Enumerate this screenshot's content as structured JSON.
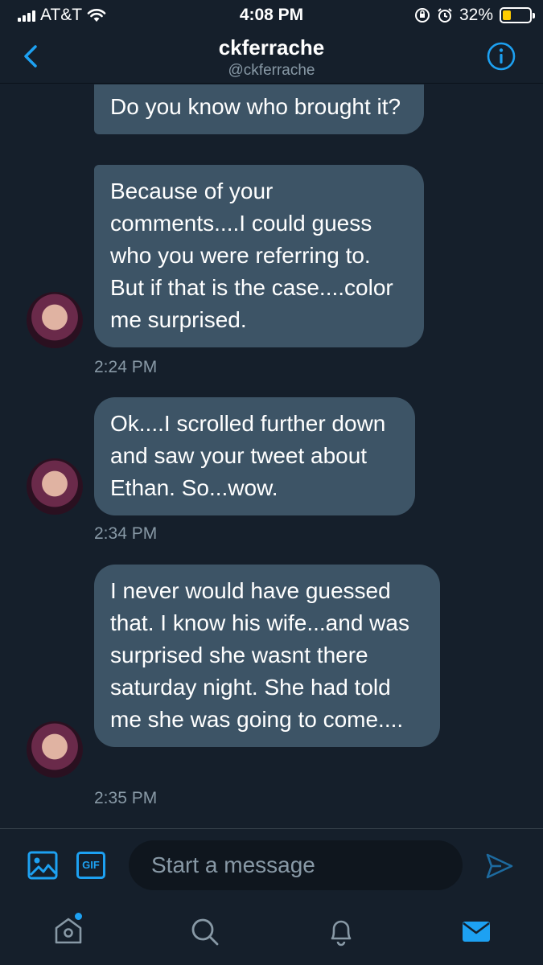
{
  "status_bar": {
    "carrier": "AT&T",
    "time": "4:08 PM",
    "battery": "32%",
    "battery_level": 0.32
  },
  "header": {
    "name": "ckferrache",
    "handle": "@ckferrache"
  },
  "messages": [
    {
      "text": "Do you know who brought it?"
    },
    {
      "text": "Because of your comments....I could guess who you were referring to. But if that is the case....color me surprised."
    },
    {
      "text": "Ok....I scrolled further down and saw your tweet about Ethan. So...wow."
    },
    {
      "text": "I never would have guessed that. I know his wife...and was surprised she wasnt there saturday night. She had told me she was going to come...."
    }
  ],
  "timestamps": [
    "2:24 PM",
    "2:34 PM",
    "2:35 PM"
  ],
  "composer": {
    "placeholder": "Start a message",
    "gif_label": "GIF"
  },
  "colors": {
    "accent": "#1da1f2",
    "background": "#151f2b",
    "bubble": "#3d5466",
    "muted": "#8899a6"
  }
}
